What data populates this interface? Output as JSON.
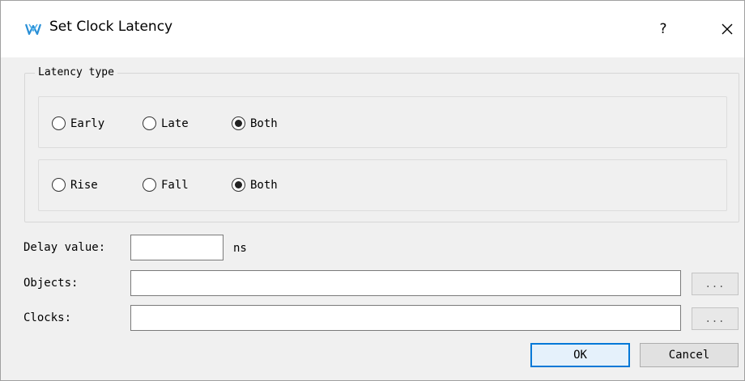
{
  "window": {
    "title": "Set Clock Latency",
    "help_glyph": "?",
    "close_glyph": "✕"
  },
  "latency_group": {
    "legend": "Latency type",
    "timing_row": [
      {
        "label": "Early",
        "checked": false
      },
      {
        "label": "Late",
        "checked": false
      },
      {
        "label": "Both",
        "checked": true
      }
    ],
    "edge_row": [
      {
        "label": "Rise",
        "checked": false
      },
      {
        "label": "Fall",
        "checked": false
      },
      {
        "label": "Both",
        "checked": true
      }
    ]
  },
  "delay": {
    "label": "Delay value:",
    "value": "",
    "unit": "ns"
  },
  "objects": {
    "label": "Objects:",
    "value": "",
    "browse_label": "..."
  },
  "clocks": {
    "label": "Clocks:",
    "value": "",
    "browse_label": "..."
  },
  "buttons": {
    "ok": "OK",
    "cancel": "Cancel"
  },
  "colors": {
    "accent": "#0078d7",
    "logo": "#2a8fd6"
  }
}
